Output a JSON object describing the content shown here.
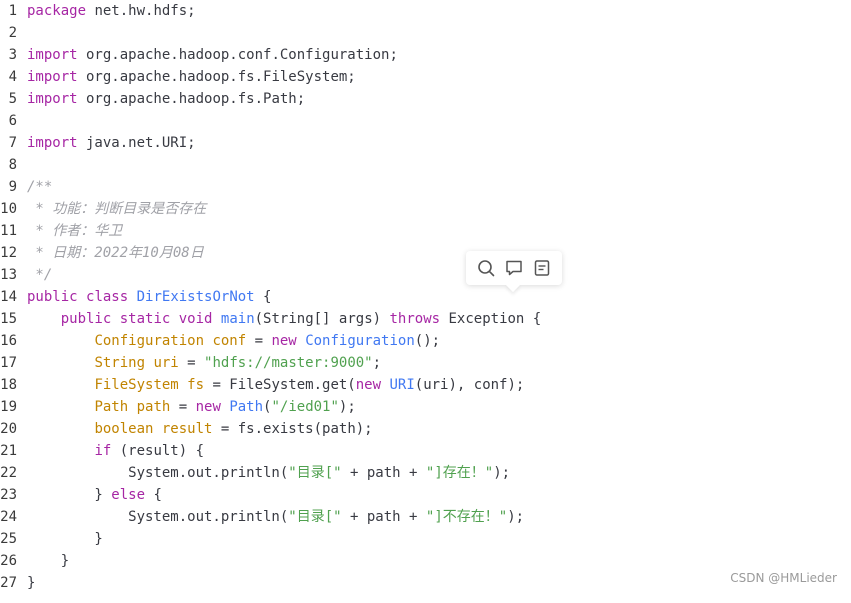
{
  "code": {
    "lines": [
      {
        "number": "1",
        "tokens": [
          {
            "t": "package",
            "c": "keyword"
          },
          {
            "t": " net.hw.hdfs;",
            "c": "plain"
          }
        ]
      },
      {
        "number": "2",
        "tokens": []
      },
      {
        "number": "3",
        "tokens": [
          {
            "t": "import",
            "c": "keyword"
          },
          {
            "t": " org.apache.hadoop.conf.Configuration;",
            "c": "plain"
          }
        ]
      },
      {
        "number": "4",
        "tokens": [
          {
            "t": "import",
            "c": "keyword"
          },
          {
            "t": " org.apache.hadoop.fs.FileSystem;",
            "c": "plain"
          }
        ]
      },
      {
        "number": "5",
        "tokens": [
          {
            "t": "import",
            "c": "keyword"
          },
          {
            "t": " org.apache.hadoop.fs.Path;",
            "c": "plain"
          }
        ]
      },
      {
        "number": "6",
        "tokens": []
      },
      {
        "number": "7",
        "tokens": [
          {
            "t": "import",
            "c": "keyword"
          },
          {
            "t": " java.net.URI;",
            "c": "plain"
          }
        ]
      },
      {
        "number": "8",
        "tokens": []
      },
      {
        "number": "9",
        "tokens": [
          {
            "t": "/**",
            "c": "comment"
          }
        ]
      },
      {
        "number": "10",
        "tokens": [
          {
            "t": " * 功能：判断目录是否存在",
            "c": "comment"
          }
        ]
      },
      {
        "number": "11",
        "tokens": [
          {
            "t": " * 作者：华卫",
            "c": "comment"
          }
        ]
      },
      {
        "number": "12",
        "tokens": [
          {
            "t": " * 日期：2022年10月08日",
            "c": "comment"
          }
        ]
      },
      {
        "number": "13",
        "tokens": [
          {
            "t": " */",
            "c": "comment"
          }
        ]
      },
      {
        "number": "14",
        "tokens": [
          {
            "t": "public",
            "c": "keyword"
          },
          {
            "t": " ",
            "c": "plain"
          },
          {
            "t": "class",
            "c": "keyword"
          },
          {
            "t": " ",
            "c": "plain"
          },
          {
            "t": "DirExistsOrNot",
            "c": "func"
          },
          {
            "t": " {",
            "c": "plain"
          }
        ]
      },
      {
        "number": "15",
        "tokens": [
          {
            "t": "    ",
            "c": "plain"
          },
          {
            "t": "public",
            "c": "keyword"
          },
          {
            "t": " ",
            "c": "plain"
          },
          {
            "t": "static",
            "c": "keyword"
          },
          {
            "t": " ",
            "c": "plain"
          },
          {
            "t": "void",
            "c": "keyword"
          },
          {
            "t": " ",
            "c": "plain"
          },
          {
            "t": "main",
            "c": "func"
          },
          {
            "t": "(String[] args) ",
            "c": "plain"
          },
          {
            "t": "throws",
            "c": "keyword"
          },
          {
            "t": " Exception {",
            "c": "plain"
          }
        ]
      },
      {
        "number": "16",
        "tokens": [
          {
            "t": "        ",
            "c": "plain"
          },
          {
            "t": "Configuration conf",
            "c": "type"
          },
          {
            "t": " = ",
            "c": "plain"
          },
          {
            "t": "new",
            "c": "keyword"
          },
          {
            "t": " ",
            "c": "plain"
          },
          {
            "t": "Configuration",
            "c": "func"
          },
          {
            "t": "();",
            "c": "plain"
          }
        ]
      },
      {
        "number": "17",
        "tokens": [
          {
            "t": "        ",
            "c": "plain"
          },
          {
            "t": "String uri",
            "c": "type"
          },
          {
            "t": " = ",
            "c": "plain"
          },
          {
            "t": "\"hdfs://master:9000\"",
            "c": "string"
          },
          {
            "t": ";",
            "c": "plain"
          }
        ]
      },
      {
        "number": "18",
        "tokens": [
          {
            "t": "        ",
            "c": "plain"
          },
          {
            "t": "FileSystem fs",
            "c": "type"
          },
          {
            "t": " = FileSystem.get(",
            "c": "plain"
          },
          {
            "t": "new",
            "c": "keyword"
          },
          {
            "t": " ",
            "c": "plain"
          },
          {
            "t": "URI",
            "c": "func"
          },
          {
            "t": "(uri), conf);",
            "c": "plain"
          }
        ]
      },
      {
        "number": "19",
        "tokens": [
          {
            "t": "        ",
            "c": "plain"
          },
          {
            "t": "Path path",
            "c": "type"
          },
          {
            "t": " = ",
            "c": "plain"
          },
          {
            "t": "new",
            "c": "keyword"
          },
          {
            "t": " ",
            "c": "plain"
          },
          {
            "t": "Path",
            "c": "func"
          },
          {
            "t": "(",
            "c": "plain"
          },
          {
            "t": "\"/ied01\"",
            "c": "string"
          },
          {
            "t": ");",
            "c": "plain"
          }
        ]
      },
      {
        "number": "20",
        "tokens": [
          {
            "t": "        ",
            "c": "plain"
          },
          {
            "t": "boolean result",
            "c": "type"
          },
          {
            "t": " = fs.exists(path);",
            "c": "plain"
          }
        ]
      },
      {
        "number": "21",
        "tokens": [
          {
            "t": "        ",
            "c": "plain"
          },
          {
            "t": "if",
            "c": "keyword"
          },
          {
            "t": " (result) {",
            "c": "plain"
          }
        ]
      },
      {
        "number": "22",
        "tokens": [
          {
            "t": "            System.out.println(",
            "c": "plain"
          },
          {
            "t": "\"目录[\"",
            "c": "string"
          },
          {
            "t": " + path + ",
            "c": "plain"
          },
          {
            "t": "\"]存在！\"",
            "c": "string"
          },
          {
            "t": ");",
            "c": "plain"
          }
        ]
      },
      {
        "number": "23",
        "tokens": [
          {
            "t": "        } ",
            "c": "plain"
          },
          {
            "t": "else",
            "c": "keyword"
          },
          {
            "t": " {",
            "c": "plain"
          }
        ]
      },
      {
        "number": "24",
        "tokens": [
          {
            "t": "            System.out.println(",
            "c": "plain"
          },
          {
            "t": "\"目录[\"",
            "c": "string"
          },
          {
            "t": " + path + ",
            "c": "plain"
          },
          {
            "t": "\"]不存在！\"",
            "c": "string"
          },
          {
            "t": ");",
            "c": "plain"
          }
        ]
      },
      {
        "number": "25",
        "tokens": [
          {
            "t": "        }",
            "c": "plain"
          }
        ]
      },
      {
        "number": "26",
        "tokens": [
          {
            "t": "    }",
            "c": "plain"
          }
        ]
      },
      {
        "number": "27",
        "tokens": [
          {
            "t": "}",
            "c": "plain"
          }
        ]
      }
    ]
  },
  "toolbar": {
    "icons": [
      "search-icon",
      "comment-icon",
      "note-icon"
    ]
  },
  "watermark": "CSDN @HMLieder",
  "colors": {
    "keyword": "#a626a4",
    "type": "#c18401",
    "string": "#50a14f",
    "function": "#4078f2",
    "comment": "#a0a1a7",
    "plain": "#383a42"
  }
}
